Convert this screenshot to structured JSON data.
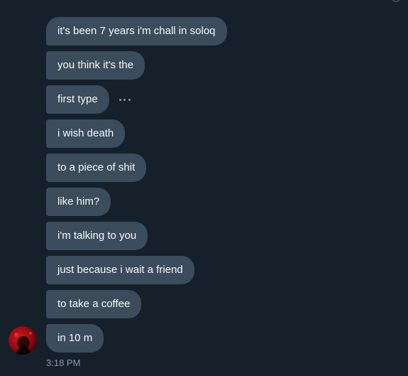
{
  "conversation": {
    "messages": [
      {
        "text": "it's been 7 years i'm chall in soloq"
      },
      {
        "text": "you think it's the"
      },
      {
        "text": "first type"
      },
      {
        "text": "i wish death"
      },
      {
        "text": "to a piece of shit"
      },
      {
        "text": "like him?"
      },
      {
        "text": "i'm talking to you"
      },
      {
        "text": "just because i wait a friend"
      },
      {
        "text": "to take a coffee"
      },
      {
        "text": "in 10 m"
      }
    ],
    "timestamp": "3:18 PM",
    "more_options_icon": "more-horizontal-icon",
    "avatar_icon": "user-avatar"
  },
  "colors": {
    "background": "#15202b",
    "bubble": "#3b4c5c",
    "bubble_text": "#f7f9f9",
    "muted_text": "#8b98a5"
  }
}
